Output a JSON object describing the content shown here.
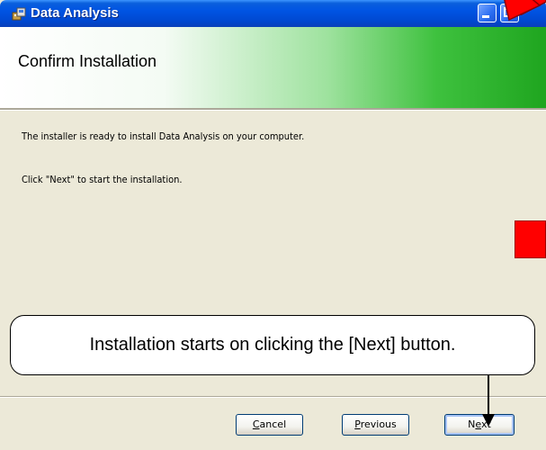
{
  "window": {
    "title": "Data Analysis",
    "minimize_icon": "minimize-icon",
    "maximize_icon": "maximize-icon",
    "app_icon": "installer-icon"
  },
  "header": {
    "title": "Confirm Installation"
  },
  "body": {
    "line1": "The installer is ready to install Data Analysis on your computer.",
    "line2": "Click \"Next\" to start the installation."
  },
  "buttons": {
    "cancel": "Cancel",
    "previous": "Previous",
    "next": "Next"
  },
  "callout": {
    "text": "Installation starts on clicking the [Next] button."
  },
  "colors": {
    "annotation_red": "#ff0000",
    "banner_green": "#1fa51f",
    "titlebar_blue": "#0054e3"
  }
}
